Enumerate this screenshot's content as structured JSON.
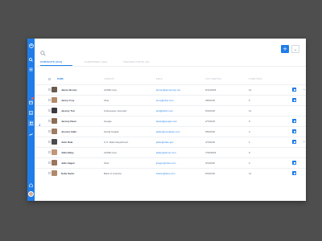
{
  "colors": {
    "accent": "#1f7ce8",
    "background": "#4e4e4e",
    "badge": "#ff5a4f"
  },
  "sidebar": {
    "icons": [
      "logo-icon",
      "search-icon",
      "menu-icon",
      "calendar-icon",
      "list-icon",
      "contacts-icon",
      "chart-icon",
      "home-icon",
      "avatar"
    ]
  },
  "header": {
    "add_icon": "+",
    "more_icon": "⌄"
  },
  "tabs": [
    {
      "label": "Contacts (213)",
      "active": true
    },
    {
      "label": "Companies (431)",
      "active": false
    },
    {
      "label": "Transactions (41)",
      "active": false
    }
  ],
  "alpha": {
    "current": "J",
    "next": "K"
  },
  "columns": [
    "Name",
    "Company",
    "Email",
    "Last Meeting",
    "# Meetings"
  ],
  "rows": [
    {
      "name": "James Brown",
      "company": "ACME Corp",
      "email": "jbrown@acmecorp.net",
      "last": "6/12/2018",
      "meetings": "12",
      "avatar_color": "#6b5a4e",
      "chevron": true
    },
    {
      "name": "Jenny Croy",
      "company": "Uber",
      "email": "jcroy@uber.com",
      "last": "2/8/2018",
      "meetings": "6",
      "avatar_color": "#b48a6a",
      "chevron": false
    },
    {
      "name": "Jeremy Tod",
      "company": "Andreessen Horowitz",
      "email": "jtod@a16z.com",
      "last": "5/4/2018",
      "meetings": "11",
      "avatar_color": "#3c3a40",
      "chevron": false
    },
    {
      "name": "Jeremy Dean",
      "company": "Google",
      "email": "jdean@google.com",
      "last": "2/7/2018",
      "meetings": "6",
      "avatar_color": "#8c6b55",
      "chevron": false
    },
    {
      "name": "Jessica Adler",
      "company": "Social Capital",
      "email": "jadler@socialcap.com",
      "last": "5/5/2018",
      "meetings": "4",
      "avatar_color": "#a07a62",
      "chevron": false
    },
    {
      "name": "John Dale",
      "company": "U.S. State Department",
      "email": "jdale@state.gov",
      "last": "4/7/2018",
      "meetings": "1",
      "avatar_color": "#4d4a4c",
      "chevron": true
    },
    {
      "name": "Julia Daley",
      "company": "ACME Corp",
      "email": "jdaley@acme.com",
      "last": "7/29/2018",
      "meetings": "9",
      "avatar_color": "#c2967a",
      "chevron": false
    },
    {
      "name": "Julie Hagen",
      "company": "Uber",
      "email": "jhagen@uber.com",
      "last": "3/1/2018",
      "meetings": "2",
      "avatar_color": "#9a7560",
      "chevron": false
    },
    {
      "name": "Kelly Santo",
      "company": "Bank of America",
      "email": "ksanto@boa.com",
      "last": "6/3/2018",
      "meetings": "11",
      "avatar_color": "#b1876b",
      "chevron": false
    }
  ]
}
